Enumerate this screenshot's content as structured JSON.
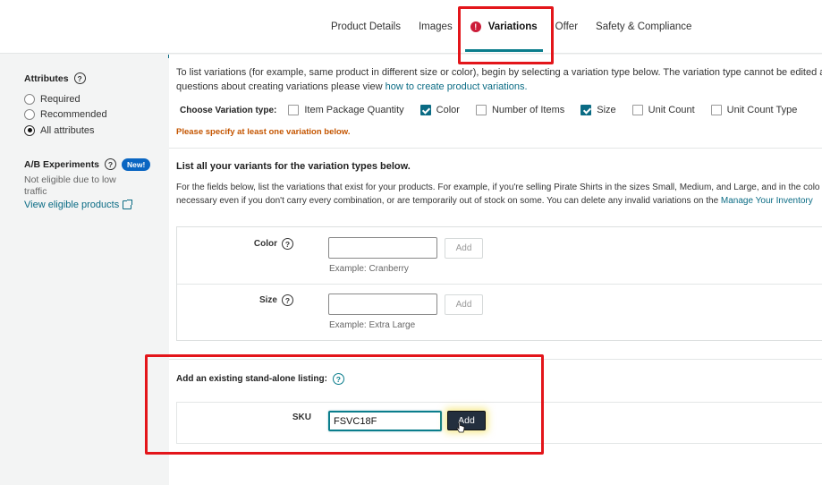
{
  "tabs": [
    {
      "label": "Product Details"
    },
    {
      "label": "Images"
    },
    {
      "label": "Variations",
      "active": true,
      "error_icon": "!"
    },
    {
      "label": "Offer"
    },
    {
      "label": "Safety & Compliance"
    }
  ],
  "sidebar": {
    "attributes_title": "Attributes",
    "help_glyph": "?",
    "options": [
      "Required",
      "Recommended",
      "All attributes"
    ],
    "selected": "All attributes",
    "ab_title": "A/B Experiments",
    "new_badge": "New!",
    "ab_desc": "Not eligible due to low traffic",
    "ab_link": "View eligible products"
  },
  "intro": {
    "line1": "To list variations (for example, same product in different size or color), begin by selecting a variation type below. The variation type cannot be edited af",
    "line2_prefix": "questions about creating variations please view ",
    "line2_link": "how to create product variations."
  },
  "variation_type": {
    "label": "Choose Variation type:",
    "options": [
      {
        "label": "Item Package Quantity",
        "checked": false
      },
      {
        "label": "Color",
        "checked": true
      },
      {
        "label": "Number of Items",
        "checked": false
      },
      {
        "label": "Size",
        "checked": true
      },
      {
        "label": "Unit Count",
        "checked": false
      },
      {
        "label": "Unit Count Type",
        "checked": false
      }
    ],
    "warning": "Please specify at least one variation below."
  },
  "variants": {
    "title": "List all your variants for the variation types below.",
    "desc_line1": "For the fields below, list the variations that exist for your products. For example, if you're selling Pirate Shirts in the sizes Small, Medium, and Large, and in the colo",
    "desc_line2_prefix": "necessary even if you don't carry every combination, or are temporarily out of stock on some. You can delete any invalid variations on the ",
    "desc_line2_link": "Manage Your Inventory",
    "fields": [
      {
        "label": "Color",
        "value": "",
        "add": "Add",
        "example": "Example: Cranberry"
      },
      {
        "label": "Size",
        "value": "",
        "add": "Add",
        "example": "Example: Extra Large"
      }
    ]
  },
  "standalone": {
    "title": "Add an existing stand-alone listing:",
    "sku_label": "SKU",
    "sku_value": "FSVC18F",
    "add": "Add"
  }
}
